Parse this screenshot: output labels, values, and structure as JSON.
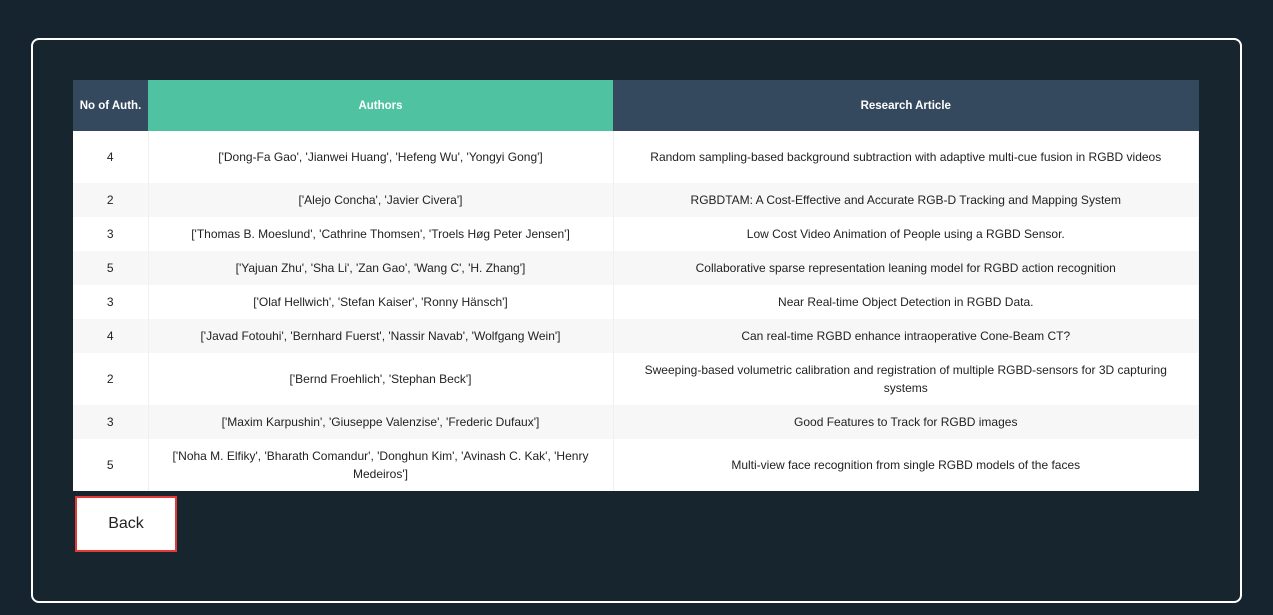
{
  "table": {
    "headers": [
      "No of Auth.",
      "Authors",
      "Research Article"
    ],
    "rows": [
      {
        "n": "4",
        "authors": "['Dong-Fa Gao', 'Jianwei Huang', 'Hefeng Wu', 'Yongyi Gong']",
        "title": "Random sampling-based background subtraction with adaptive multi-cue fusion in RGBD videos",
        "tall": true
      },
      {
        "n": "2",
        "authors": "['Alejo Concha', 'Javier Civera']",
        "title": "RGBDTAM: A Cost-Effective and Accurate RGB-D Tracking and Mapping System"
      },
      {
        "n": "3",
        "authors": "['Thomas B. Moeslund', 'Cathrine Thomsen', 'Troels Høg Peter Jensen']",
        "title": "Low Cost Video Animation of People using a RGBD Sensor."
      },
      {
        "n": "5",
        "authors": "['Yajuan Zhu', 'Sha Li', 'Zan Gao', 'Wang C', 'H. Zhang']",
        "title": "Collaborative sparse representation leaning model for RGBD action recognition"
      },
      {
        "n": "3",
        "authors": "['Olaf Hellwich', 'Stefan Kaiser', 'Ronny Hänsch']",
        "title": "Near Real-time Object Detection in RGBD Data."
      },
      {
        "n": "4",
        "authors": "['Javad Fotouhi', 'Bernhard Fuerst', 'Nassir Navab', 'Wolfgang Wein']",
        "title": "Can real-time RGBD enhance intraoperative Cone-Beam CT?"
      },
      {
        "n": "2",
        "authors": "['Bernd Froehlich', 'Stephan Beck']",
        "title": "Sweeping-based volumetric calibration and registration of multiple RGBD-sensors for 3D capturing systems",
        "tall": true
      },
      {
        "n": "3",
        "authors": "['Maxim Karpushin', 'Giuseppe Valenzise', 'Frederic Dufaux']",
        "title": "Good Features to Track for RGBD images"
      },
      {
        "n": "5",
        "authors": "['Noha M. Elfiky', 'Bharath Comandur', 'Donghun Kim', 'Avinash C. Kak', 'Henry Medeiros']",
        "title": "Multi-view face recognition from single RGBD models of the faces",
        "tall": true
      }
    ]
  },
  "back_label": "Back"
}
